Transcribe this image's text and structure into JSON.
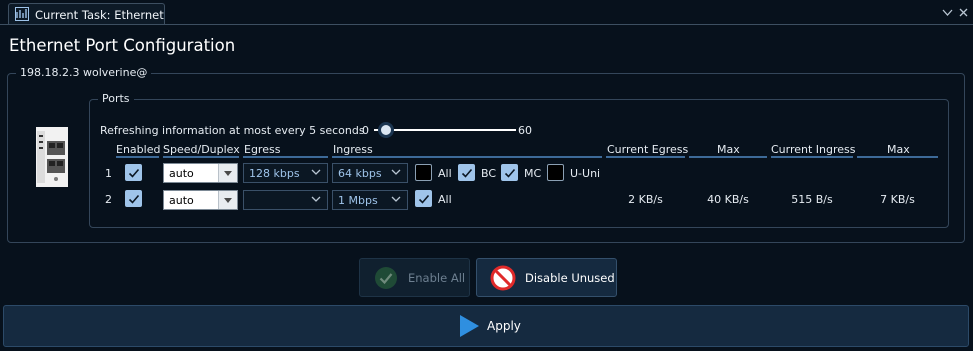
{
  "tab": {
    "title": "Current Task: Ethernet"
  },
  "page": {
    "title": "Ethernet Port Configuration"
  },
  "device_group": {
    "label": "198.18.2.3 wolverine@"
  },
  "ports_group": {
    "label": "Ports"
  },
  "refresh": {
    "text": "Refreshing information at most every 5 seconds",
    "min_label": "0",
    "max_label": "60",
    "value": 5
  },
  "table": {
    "headers": {
      "enabled": "Enabled",
      "speed": "Speed/Duplex",
      "egress": "Egress",
      "ingress": "Ingress",
      "current_egress": "Current Egress",
      "max_egress": "Max",
      "current_ingress": "Current Ingress",
      "max_ingress": "Max"
    },
    "rows": [
      {
        "port": "1",
        "enabled": true,
        "speed": "auto",
        "egress": "128 kbps",
        "ingress": "64 kbps",
        "filters": {
          "all_label": "All",
          "all": false,
          "bc_label": "BC",
          "bc": true,
          "mc_label": "MC",
          "mc": true,
          "uuni_label": "U-Uni",
          "uuni": false
        },
        "current_egress": "",
        "max_egress": "",
        "current_ingress": "",
        "max_ingress": ""
      },
      {
        "port": "2",
        "enabled": true,
        "speed": "auto",
        "egress": "",
        "ingress": "1 Mbps",
        "filters": {
          "all_label": "All",
          "all": true
        },
        "current_egress": "2 KB/s",
        "max_egress": "40 KB/s",
        "current_ingress": "515 B/s",
        "max_ingress": "7 KB/s"
      }
    ]
  },
  "buttons": {
    "enable_all": "Enable All",
    "disable_unused": "Disable Unused",
    "apply": "Apply"
  },
  "colors": {
    "background": "#07111c",
    "accent": "#9fc4ea",
    "apply_icon": "#2f8fe0",
    "disable_icon": "#e02a2a",
    "enable_icon": "#3b8a5a"
  }
}
